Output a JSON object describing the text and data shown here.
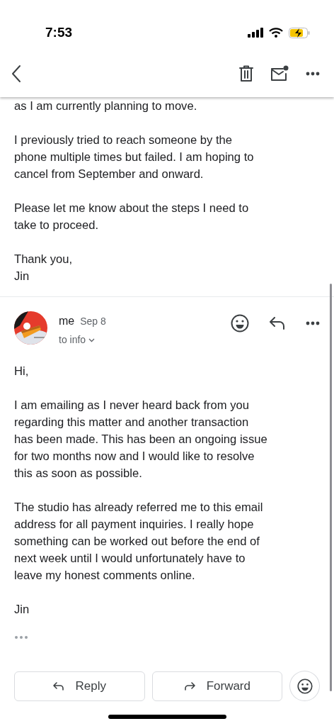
{
  "status_bar": {
    "time": "7:53"
  },
  "messages": [
    {
      "paragraphs": [
        "as I am currently planning to move.",
        "I previously tried to reach someone by the\nphone multiple times but failed. I am hoping to\ncancel from September and onward.",
        "Please let me know about the steps I need to\ntake to proceed.",
        "Thank you,\nJin"
      ]
    },
    {
      "sender": "me",
      "date": "Sep 8",
      "recipients": "to info",
      "paragraphs": [
        "Hi,",
        "I am emailing as I never heard back from you\nregarding this matter and another transaction\nhas been made. This has been an ongoing issue\nfor two months now and I would like to resolve\nthis as soon as possible.",
        "The studio has already referred me to this email\naddress for all payment inquiries. I really hope\nsomething can be worked out before the end of\nnext week until I would unfortunately have to\nleave my honest comments online.",
        "Jin"
      ]
    }
  ],
  "actions": [
    {
      "kind": "reply",
      "label": "Reply"
    },
    {
      "kind": "forward",
      "label": "Forward"
    }
  ]
}
